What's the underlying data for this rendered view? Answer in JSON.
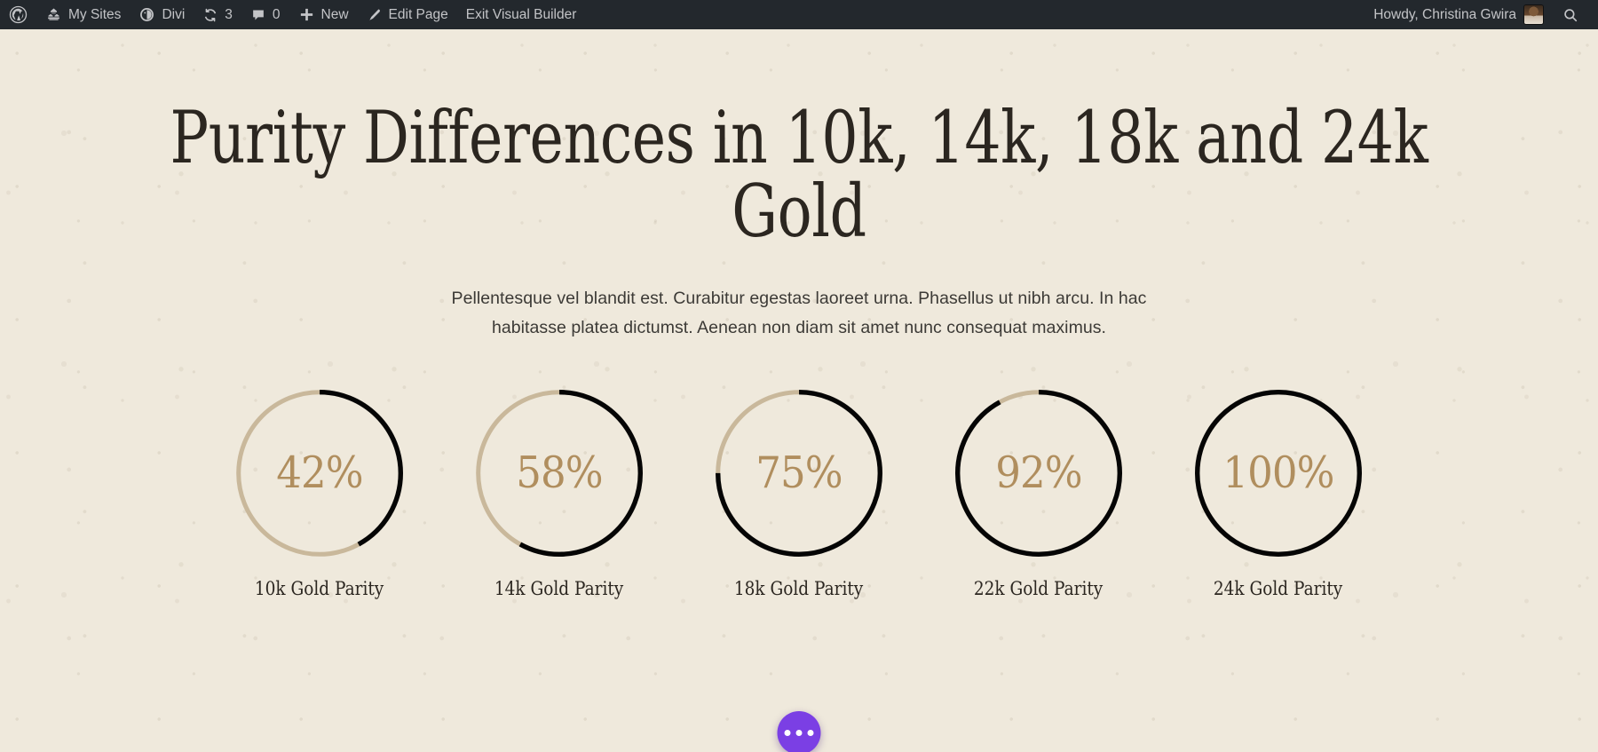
{
  "admin_bar": {
    "left_items": [
      {
        "id": "wp-logo",
        "icon": "wordpress-logo-icon",
        "label": ""
      },
      {
        "id": "my-sites",
        "icon": "sites-icon",
        "label": "My Sites"
      },
      {
        "id": "divi",
        "icon": "divi-icon",
        "label": "Divi"
      },
      {
        "id": "updates",
        "icon": "updates-icon",
        "label": "3"
      },
      {
        "id": "comments",
        "icon": "comment-bubble-icon",
        "label": "0"
      },
      {
        "id": "new-content",
        "icon": "plus-icon",
        "label": "New"
      },
      {
        "id": "edit-page",
        "icon": "pencil-icon",
        "label": "Edit Page"
      },
      {
        "id": "exit-vb",
        "icon": "",
        "label": "Exit Visual Builder"
      }
    ],
    "howdy_label": "Howdy, Christina Gwira",
    "search_icon": "search-icon",
    "avatar_name": "user-avatar",
    "bar_bg": "#23282D",
    "bar_text": "#C3C4C7"
  },
  "page": {
    "background_color": "#EFE9DC",
    "heading": "Purity Differences in 10k, 14k, 18k and 24k Gold",
    "subtext": "Pellentesque vel blandit est. Curabitur egestas laoreet urna. Phasellus ut nibh arcu. In hac habitasse platea dictumst. Aenean non diam sit amet nunc consequat maximus."
  },
  "chart_data": {
    "type": "pie",
    "title": "Purity Differences in 10k, 14k, 18k and 24k Gold",
    "subtitle": "Pellentesque vel blandit est. Curabitur egestas laoreet urna. Phasellus ut nibh arcu. In hac habitasse platea dictumst. Aenean non diam sit amet nunc consequat maximus.",
    "xlabel": "",
    "ylabel": "",
    "ylim": [
      0,
      100
    ],
    "grid": false,
    "legend": "none",
    "unit": "%",
    "start_angle_deg": 0,
    "direction": "clockwise",
    "fill_color": "#050505",
    "track_color": "#C9B89B",
    "value_text_color": "#B08E5E",
    "categories": [
      "10k Gold Parity",
      "14k Gold Parity",
      "18k Gold Parity",
      "22k Gold Parity",
      "24k Gold Parity"
    ],
    "values": [
      42,
      58,
      75,
      92,
      100
    ],
    "value_labels": [
      "42%",
      "58%",
      "75%",
      "92%",
      "100%"
    ]
  },
  "counters": [
    {
      "percent_label": "42%",
      "percent": 42,
      "title": "10k Gold Parity"
    },
    {
      "percent_label": "58%",
      "percent": 58,
      "title": "14k Gold Parity"
    },
    {
      "percent_label": "75%",
      "percent": 75,
      "title": "18k Gold Parity"
    },
    {
      "percent_label": "92%",
      "percent": 92,
      "title": "22k Gold Parity"
    },
    {
      "percent_label": "100%",
      "percent": 100,
      "title": "24k Gold Parity"
    }
  ],
  "fab": {
    "name": "divi-builder-toggle",
    "icon": "ellipsis-icon",
    "color": "#7B3FE4",
    "dot_count": 3
  }
}
